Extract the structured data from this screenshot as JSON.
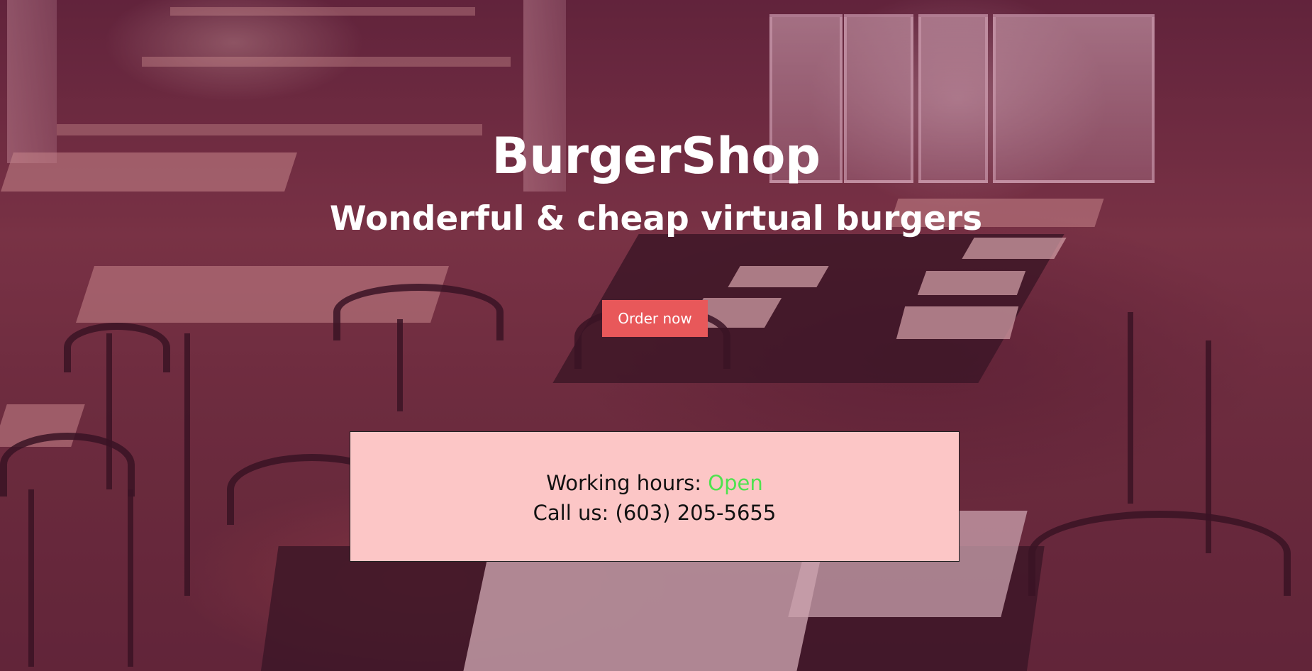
{
  "hero": {
    "title": "BurgerShop",
    "subtitle": "Wonderful & cheap virtual burgers",
    "order_button_label": "Order now"
  },
  "info": {
    "hours_label": "Working hours: ",
    "hours_status": "Open",
    "call_label": "Call us: ",
    "phone": "(603) 205-5655"
  },
  "colors": {
    "button_bg": "#e8585a",
    "info_bg": "#fcc6c6",
    "status_open": "#4fe24f",
    "hero_text": "#ffffff"
  }
}
